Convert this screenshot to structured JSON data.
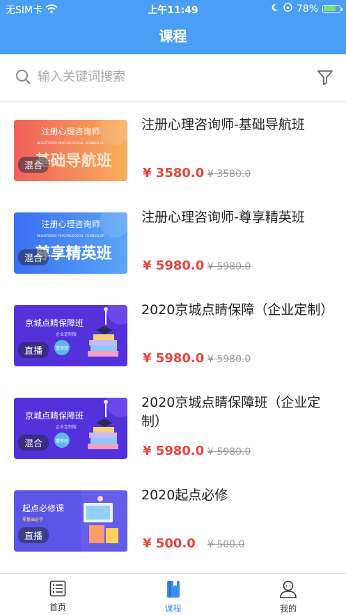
{
  "status_bar": {
    "carrier": "无SIM卡",
    "time": "上午11:49",
    "battery": "78%",
    "battery_level": 0.78
  },
  "nav": {
    "title": "课程"
  },
  "search": {
    "placeholder": "输入关键词搜索"
  },
  "courses": [
    {
      "title": "注册心理咨询师-基础导航班",
      "price": "¥ 3580.0",
      "original_price": "¥ 3580.0",
      "badge": "混合",
      "thumb": {
        "heading": "注册心理咨询师",
        "sub": "REGISTERED PSYCHOLOGICAL COUNSELOR",
        "big": "基础导航班",
        "style": "orange"
      }
    },
    {
      "title": "注册心理咨询师-尊享精英班",
      "price": "¥ 5980.0",
      "original_price": "¥ 5980.0",
      "badge": "混合",
      "thumb": {
        "heading": "注册心理咨询师",
        "sub": "REGISTERED PSYCHOLOGICAL COUNSELOR",
        "big": "尊享精英班",
        "style": "blue"
      }
    },
    {
      "title": "2020京城点睛保障（企业定制）",
      "price": "¥ 5980.0",
      "original_price": "¥ 5980.0",
      "badge": "直播",
      "thumb": {
        "heading": "京城点睛保障班",
        "sub": "企业定制版",
        "big": "重修班",
        "style": "purple"
      }
    },
    {
      "title": "2020京城点睛保障班（企业定制）",
      "price": "¥ 5980.0",
      "original_price": "¥ 5980.0",
      "badge": "混合",
      "thumb": {
        "heading": "京城点睛保障班",
        "sub": "企业定制版",
        "big": "重修班",
        "style": "purple"
      }
    },
    {
      "title": "2020起点必修",
      "price": "¥ 500.0",
      "original_price": "¥ 500.0",
      "badge": "直播",
      "thumb": {
        "heading": "起点必修课",
        "sub": "零基础必学",
        "big": "",
        "style": "indigo"
      }
    }
  ],
  "tabbar": [
    {
      "label": "首页",
      "icon": "list-icon",
      "active": false
    },
    {
      "label": "课程",
      "icon": "book-icon",
      "active": true
    },
    {
      "label": "我的",
      "icon": "user-icon",
      "active": false
    }
  ],
  "colors": {
    "primary": "#4a9ef3",
    "price": "#e8453c",
    "tab_active": "#3a8ef0"
  }
}
